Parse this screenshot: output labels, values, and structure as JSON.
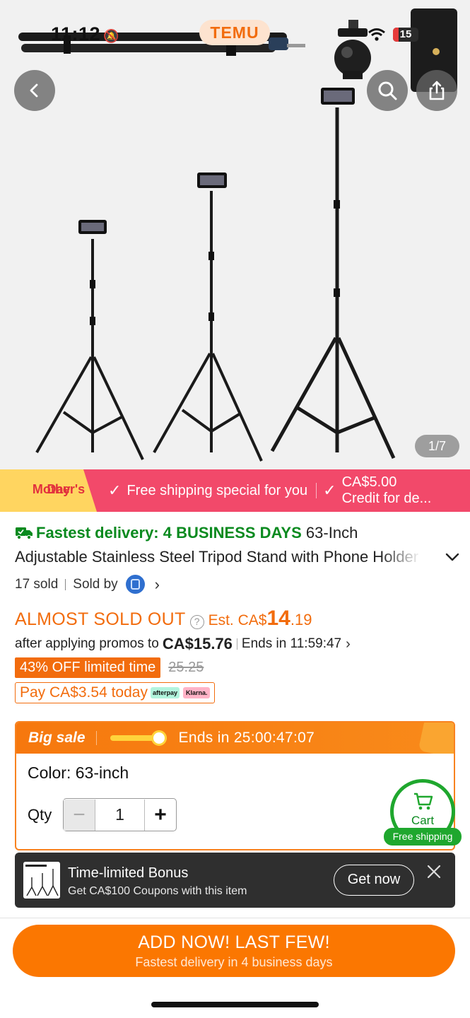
{
  "status_bar": {
    "time": "11:12",
    "battery": "15"
  },
  "brand": {
    "name": "TEMU"
  },
  "image_counter": "1/7",
  "banner": {
    "badge_line1": "Mother's",
    "badge_line2": "Day",
    "free_shipping": "Free shipping special for you",
    "credit_line1": "CA$5.00",
    "credit_line2": "Credit for de..."
  },
  "product": {
    "delivery": "Fastest delivery: 4 BUSINESS DAYS",
    "title_start": "63-Inch",
    "title_rest": "Adjustable Stainless Steel Tripod Stand with Phone Holder",
    "sold": "17 sold",
    "sold_by": "Sold by"
  },
  "pricing": {
    "almost_sold_out": "ALMOST SOLD OUT",
    "est_prefix": "Est. CA$",
    "est_whole": "14",
    "est_decimal": ".19",
    "after_promos": "after applying promos to",
    "promo_price": "CA$15.76",
    "ends_in": "Ends in 11:59:47",
    "off_badge": "43% OFF limited time",
    "original_price": "25.25",
    "pay_today": "Pay CA$3.54 today",
    "afterpay": "afterpay",
    "klarna": "Klarna."
  },
  "big_sale": {
    "label": "Big sale",
    "ends": "Ends in 25:00:47:07",
    "progress": 0.85,
    "color_label": "Color: 63-inch",
    "qty_label": "Qty",
    "qty_value": "1",
    "minus": "−",
    "plus": "+"
  },
  "cart": {
    "label": "Cart",
    "free_shipping": "Free shipping"
  },
  "bonus_toast": {
    "title": "Time-limited Bonus",
    "subtitle": "Get CA$100 Coupons with this item",
    "button": "Get now"
  },
  "cta": {
    "line1": "ADD NOW! LAST FEW!",
    "line2": "Fastest delivery in 4 business days"
  },
  "colors": {
    "accent_orange": "#fb7701",
    "banner_pink": "#f2496a",
    "delivery_green": "#0a8a1f"
  }
}
